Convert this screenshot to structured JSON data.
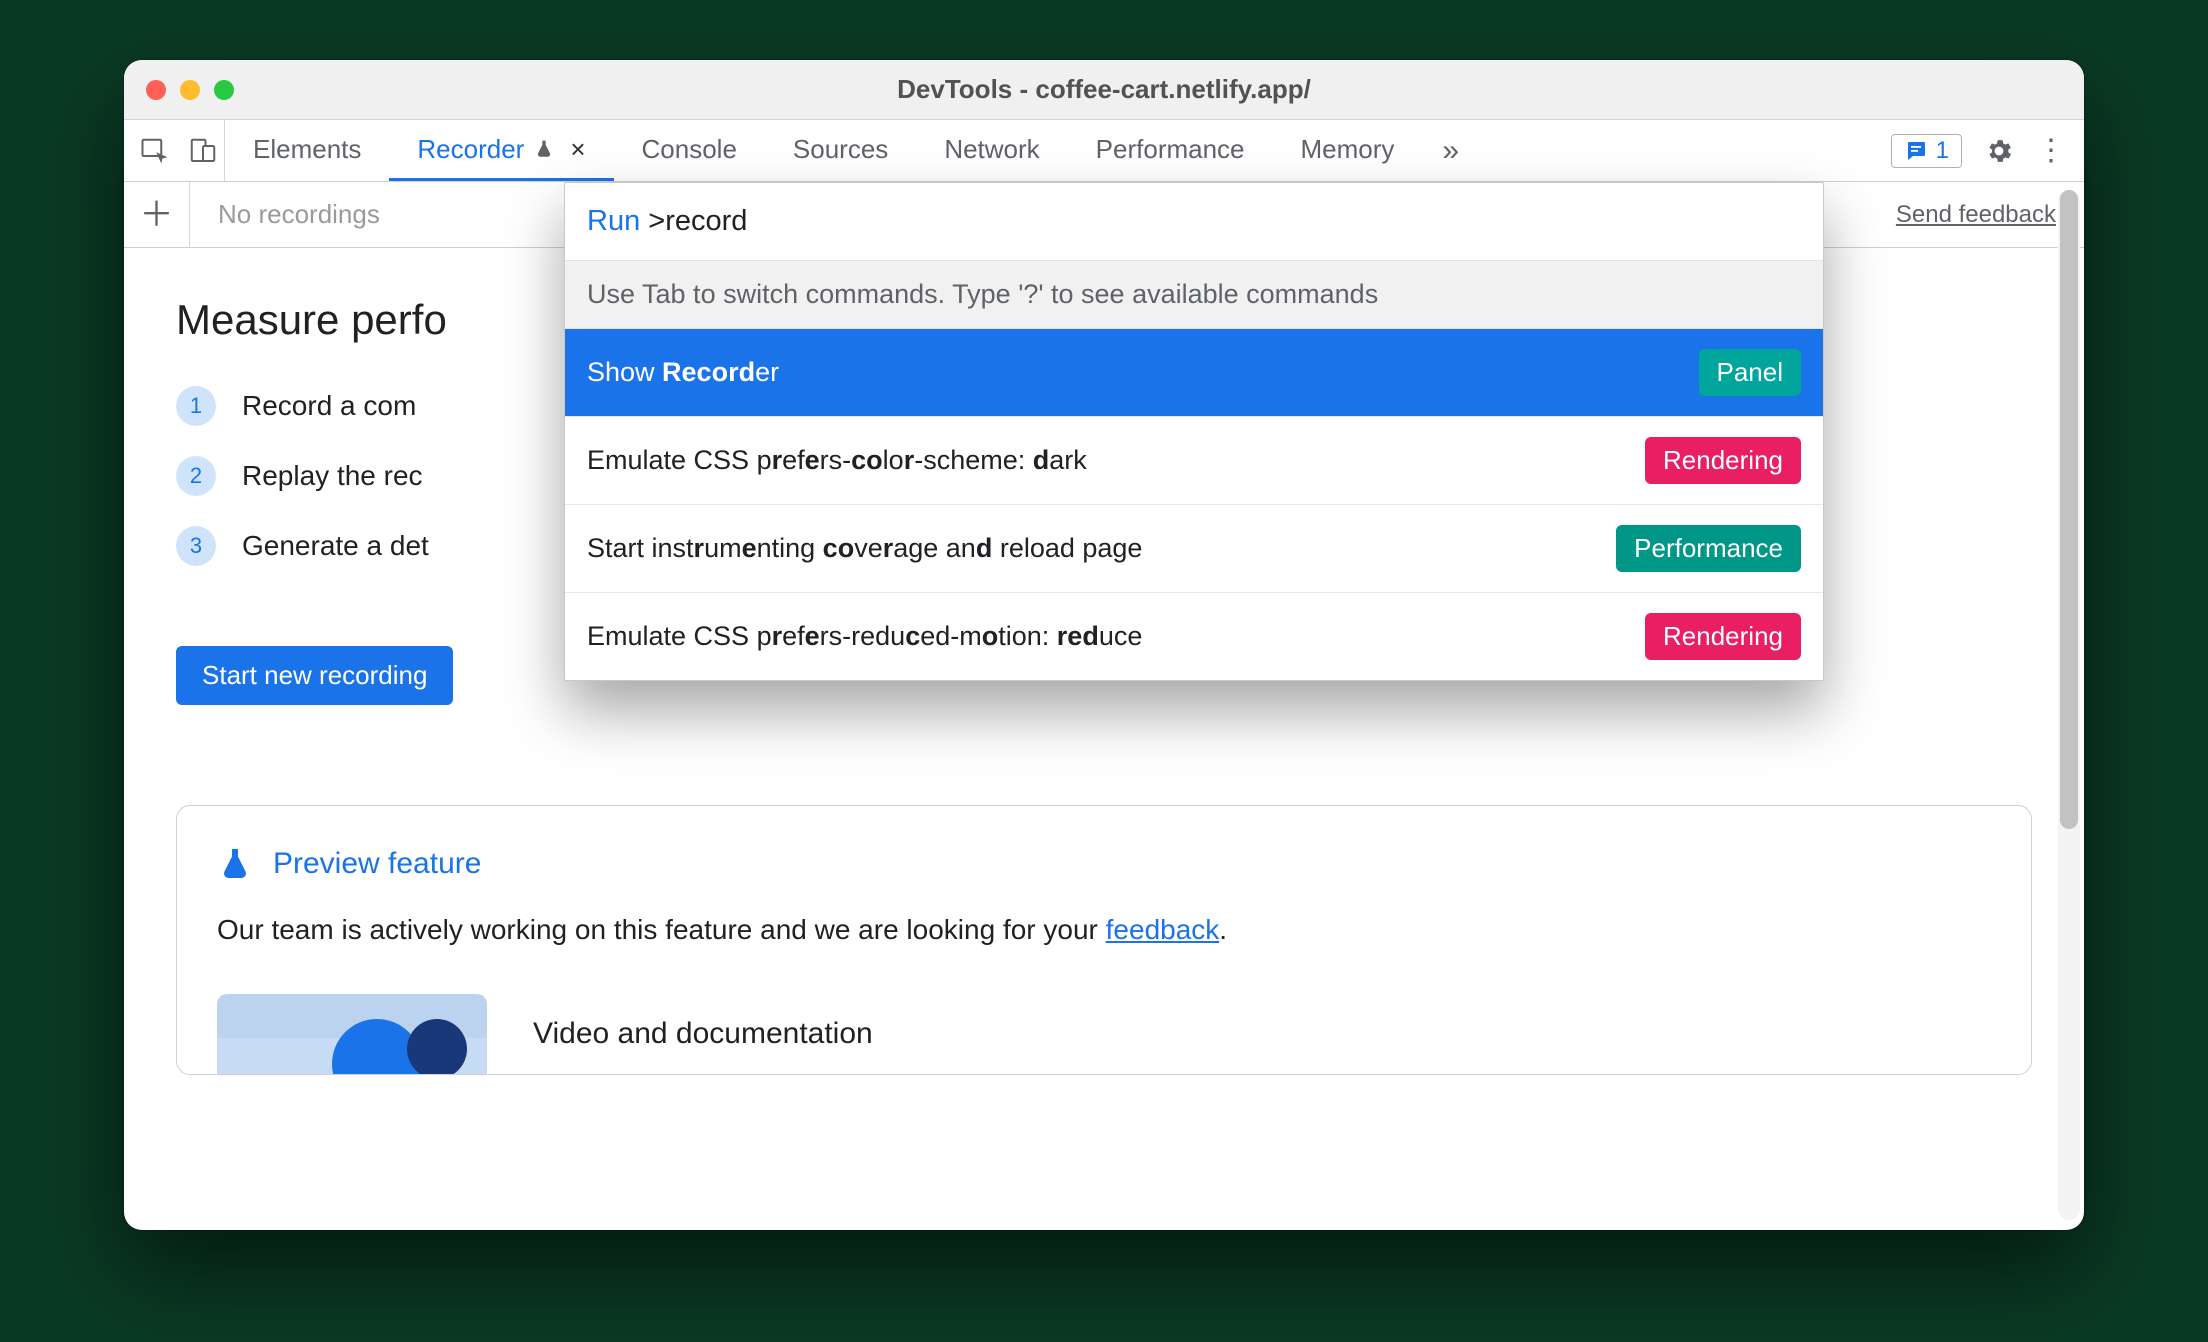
{
  "window": {
    "title": "DevTools - coffee-cart.netlify.app/"
  },
  "tabs": {
    "items": [
      "Elements",
      "Recorder",
      "Console",
      "Sources",
      "Network",
      "Performance",
      "Memory"
    ],
    "active_index": 1,
    "overflow_glyph": "»"
  },
  "msg_count": "1",
  "subbar": {
    "placeholder": "No recordings",
    "feedback_label": "Send feedback"
  },
  "content": {
    "heading": "Measure perfo",
    "steps": [
      "Record a com",
      "Replay the rec",
      "Generate a det"
    ],
    "start_button": "Start new recording"
  },
  "preview": {
    "title": "Preview feature",
    "text_before": "Our team is actively working on this feature and we are looking for your ",
    "link": "feedback",
    "text_after": ".",
    "media_title": "Video and documentation"
  },
  "palette": {
    "prefix": "Run",
    "symbol": ">",
    "query": "record",
    "hint": "Use Tab to switch commands. Type '?' to see available commands",
    "items": [
      {
        "html": "Show <b>Record</b>er",
        "badge": "Panel",
        "badge_class": "panel",
        "selected": true
      },
      {
        "html": "Emulate CSS p<b>r</b>ef<b>e</b>rs-<b>co</b>lo<b>r</b>-scheme: <b>d</b>ark",
        "badge": "Rendering",
        "badge_class": "rendering",
        "selected": false
      },
      {
        "html": "Start inst<b>r</b>um<b>e</b>nting <b>co</b>ve<b>r</b>age an<b>d</b> reload page",
        "badge": "Performance",
        "badge_class": "performance",
        "selected": false
      },
      {
        "html": "Emulate CSS p<b>r</b>ef<b>e</b>rs-redu<b>c</b>ed-m<b>o</b>tion: <b>red</b>uce",
        "badge": "Rendering",
        "badge_class": "rendering",
        "selected": false
      }
    ]
  }
}
